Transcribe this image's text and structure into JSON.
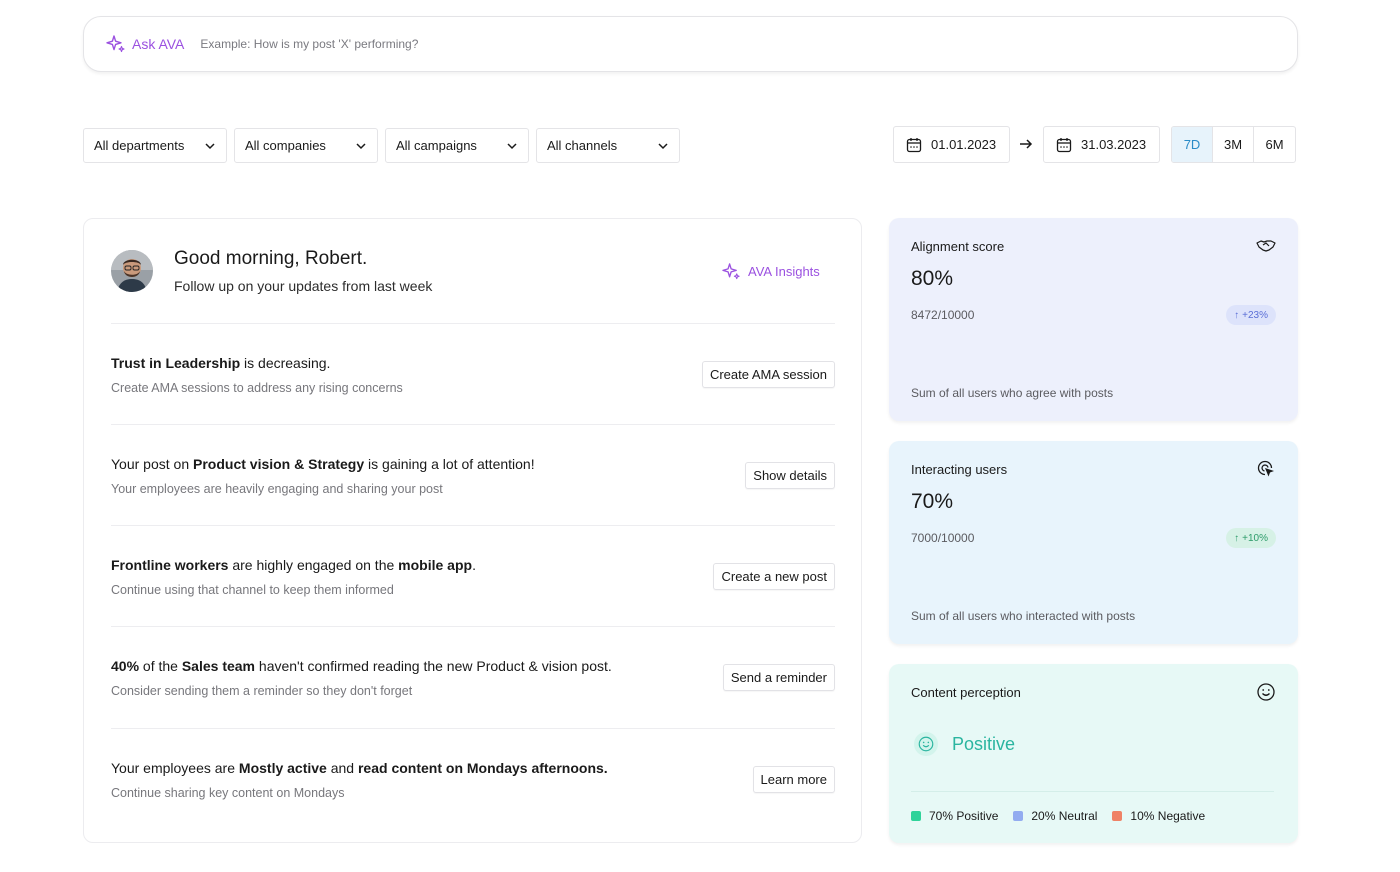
{
  "ask_bar": {
    "label": "Ask AVA",
    "placeholder": "Example: How is my post 'X' performing?"
  },
  "filters": [
    {
      "label": "All departments"
    },
    {
      "label": "All companies"
    },
    {
      "label": "All campaigns"
    },
    {
      "label": "All channels"
    }
  ],
  "date_range": {
    "start": "01.01.2023",
    "end": "31.03.2023",
    "ranges": [
      "7D",
      "3M",
      "6M"
    ],
    "active_range": "7D"
  },
  "greeting": {
    "title": "Good morning, Robert.",
    "subtitle": "Follow up on your updates from last week",
    "ava_insights_label": "AVA Insights"
  },
  "insights": [
    {
      "title_parts": [
        {
          "text": "Trust in Leadership",
          "bold": true
        },
        {
          "text": " is decreasing.",
          "bold": false
        }
      ],
      "subtitle": "Create AMA sessions to address any rising concerns",
      "button": "Create AMA session"
    },
    {
      "title_parts": [
        {
          "text": "Your post on ",
          "bold": false
        },
        {
          "text": "Product vision & Strategy",
          "bold": true
        },
        {
          "text": " is gaining a lot of attention!",
          "bold": false
        }
      ],
      "subtitle": "Your employees are heavily engaging and sharing your post",
      "button": "Show details"
    },
    {
      "title_parts": [
        {
          "text": "Frontline workers",
          "bold": true
        },
        {
          "text": " are highly engaged on the ",
          "bold": false
        },
        {
          "text": "mobile app",
          "bold": true
        },
        {
          "text": ".",
          "bold": false
        }
      ],
      "subtitle": "Continue using that channel to keep them informed",
      "button": "Create a new post"
    },
    {
      "title_parts": [
        {
          "text": "40%",
          "bold": true
        },
        {
          "text": " of the ",
          "bold": false
        },
        {
          "text": "Sales team",
          "bold": true
        },
        {
          "text": " haven't confirmed reading the new Product & vision post.",
          "bold": false
        }
      ],
      "subtitle": "Consider sending them a reminder so they don't forget",
      "button": "Send a reminder"
    },
    {
      "title_parts": [
        {
          "text": "Your employees are ",
          "bold": false
        },
        {
          "text": "Mostly active",
          "bold": true
        },
        {
          "text": " and ",
          "bold": false
        },
        {
          "text": "read content on Mondays afternoons.",
          "bold": true
        }
      ],
      "subtitle": "Continue sharing key content on Mondays",
      "button": "Learn more"
    }
  ],
  "metrics": {
    "alignment": {
      "title": "Alignment score",
      "value": "80%",
      "count": "8472/10000",
      "badge": "+23%",
      "description": "Sum of all users who agree with posts",
      "icon": "handshake-icon",
      "bg": "#edf0fc",
      "badge_color": "#5b6fd6",
      "badge_bg": "#dde3fb"
    },
    "interacting": {
      "title": "Interacting users",
      "value": "70%",
      "count": "7000/10000",
      "badge": "+10%",
      "description": "Sum of all users who interacted with posts",
      "icon": "click-target-icon",
      "bg": "#e8f4fc",
      "badge_color": "#2e9c6a",
      "badge_bg": "#d6f1e6"
    },
    "perception": {
      "title": "Content perception",
      "value": "Positive",
      "icon": "smiley-icon",
      "bg": "#e7f9f6",
      "legend": [
        {
          "label": "70% Positive",
          "color": "#2fd39a"
        },
        {
          "label": "20% Neutral",
          "color": "#93acf0"
        },
        {
          "label": "10% Negative",
          "color": "#ef8266"
        }
      ]
    }
  }
}
